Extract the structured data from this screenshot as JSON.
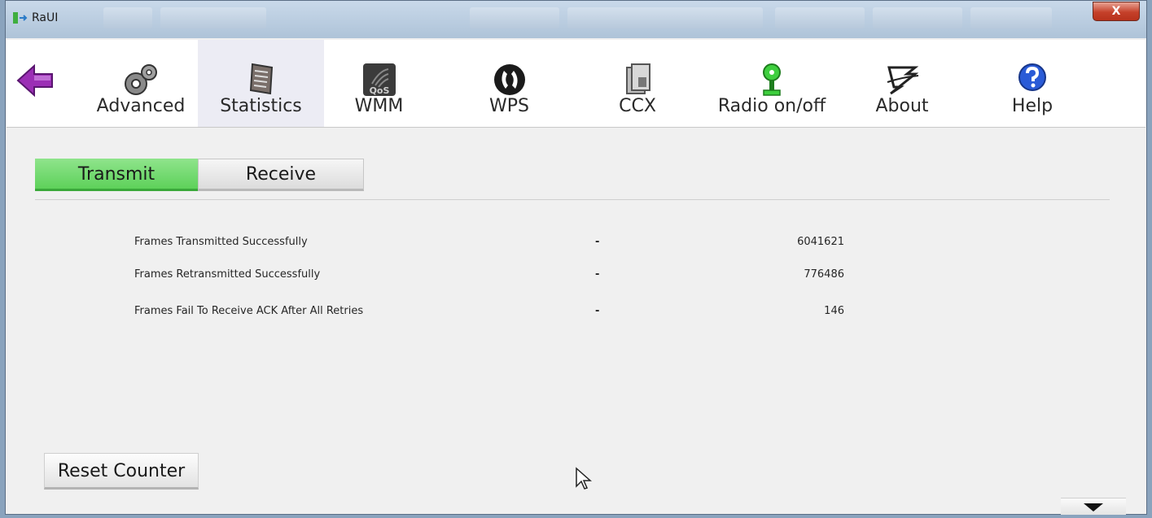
{
  "window": {
    "title": "RaUI",
    "close_label": "X"
  },
  "toolbar": {
    "back_icon": "back-arrow-icon",
    "items": [
      {
        "label": "Advanced",
        "icon": "gears-icon",
        "active": false
      },
      {
        "label": "Statistics",
        "icon": "statistics-icon",
        "active": true
      },
      {
        "label": "WMM",
        "icon": "wmm-qos-icon",
        "active": false
      },
      {
        "label": "WPS",
        "icon": "wps-icon",
        "active": false
      },
      {
        "label": "CCX",
        "icon": "ccx-icon",
        "active": false
      },
      {
        "label": "Radio on/off",
        "icon": "radio-icon",
        "active": false
      },
      {
        "label": "About",
        "icon": "about-icon",
        "active": false
      },
      {
        "label": "Help",
        "icon": "help-icon",
        "active": false
      }
    ],
    "wmm_icon_text": "QoS"
  },
  "tabs": {
    "transmit": "Transmit",
    "receive": "Receive",
    "active": "transmit"
  },
  "stats": [
    {
      "label": "Frames Transmitted Successfully",
      "separator": "-",
      "value": "6041621"
    },
    {
      "label": "Frames Retransmitted Successfully",
      "separator": "-",
      "value": "776486"
    },
    {
      "label": "Frames Fail To Receive ACK After All Retries",
      "separator": "-",
      "value": "146"
    }
  ],
  "buttons": {
    "reset": "Reset Counter"
  },
  "colors": {
    "active_tab": "#5ed15a",
    "close_button": "#c5402a",
    "back_arrow": "#9b2fb5",
    "help_icon": "#2a5bd7"
  }
}
